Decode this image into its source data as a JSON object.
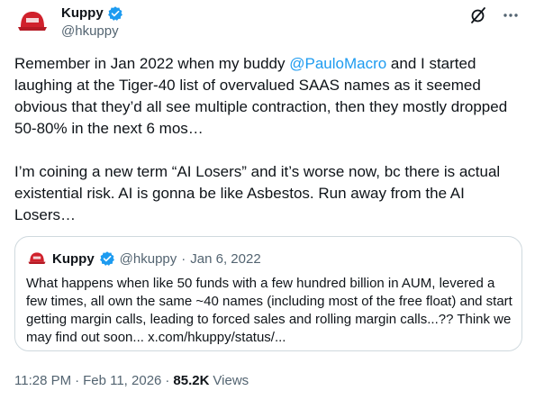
{
  "author": {
    "display_name": "Kuppy",
    "handle": "@hkuppy",
    "avatar": "red-hat-avatar"
  },
  "header_actions": [
    "grok-icon",
    "more-icon"
  ],
  "tweet": {
    "text_before_mention": "Remember in Jan 2022 when my buddy ",
    "mention": "@PauloMacro",
    "text_after_mention": " and I started laughing at the Tiger-40 list of overvalued SAAS names as it seemed obvious that they’d all see multiple contraction, then they mostly dropped 50-80% in the next 6 mos…\n\nI’m coining a new term “AI Losers” and it’s worse now, bc there is actual existential risk. AI is gonna be like Asbestos. Run away from the AI Losers…"
  },
  "quote": {
    "display_name": "Kuppy",
    "handle": "@hkuppy",
    "separator": "·",
    "date": "Jan 6, 2022",
    "text": "What happens when like 50 funds with a few hundred billion in AUM, levered a few times, all own the same ~40 names (including most of the free float) and start getting margin calls, leading to forced sales and rolling margin calls...?? Think we may find out soon... x.com/hkuppy/status/..."
  },
  "footer": {
    "time": "11:28 PM",
    "sep1": "·",
    "date": "Feb 11, 2026",
    "sep2": "·",
    "views_count": "85.2K",
    "views_label": "Views"
  },
  "colors": {
    "accent": "#1d9bf0",
    "text": "#0f1419",
    "muted": "#536471",
    "border": "#cfd9de",
    "hat_red": "#d0212c"
  }
}
